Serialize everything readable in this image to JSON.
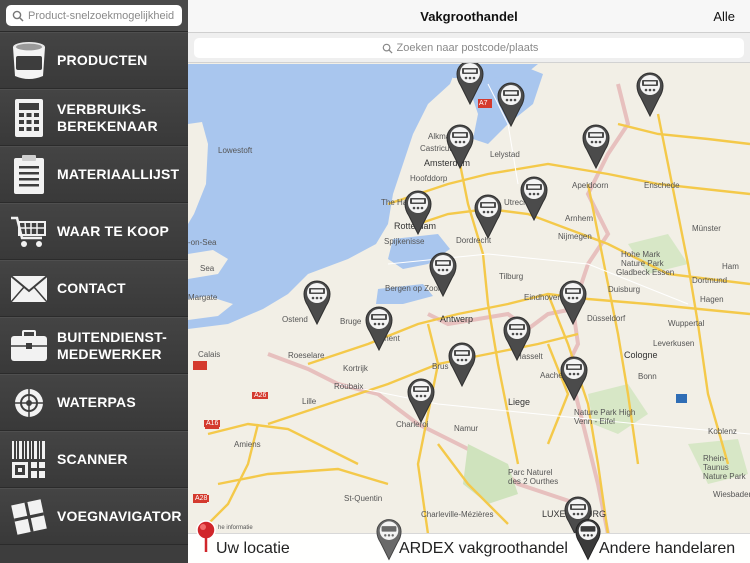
{
  "sidebar": {
    "search_placeholder": "Product-snelzoekmogelijkheid",
    "items": [
      {
        "label": "PRODUCTEN",
        "icon": "bucket-icon"
      },
      {
        "label": "VERBRUIKS-\nBEREKENAAR",
        "icon": "calculator-icon"
      },
      {
        "label": "MATERIAALLIJST",
        "icon": "list-icon"
      },
      {
        "label": "WAAR TE KOOP",
        "icon": "cart-icon"
      },
      {
        "label": "CONTACT",
        "icon": "envelope-icon"
      },
      {
        "label": "BUITENDIENST-\nMEDEWERKER",
        "icon": "briefcase-icon"
      },
      {
        "label": "WATERPAS",
        "icon": "level-icon"
      },
      {
        "label": "SCANNER",
        "icon": "qr-code-icon"
      },
      {
        "label": "VOEGNAVIGATOR",
        "icon": "tile-icon"
      }
    ]
  },
  "nav": {
    "title": "Vakgroothandel",
    "right_label": "Alle"
  },
  "postcode_search": {
    "placeholder": "Zoeken naar postcode/plaats"
  },
  "map": {
    "labels": {
      "lowestoft": "Lowestoft",
      "castricum": "Castricum",
      "alkmaar": "Alkmaar",
      "amsterdam": "Amsterdam",
      "lelystad": "Lelystad",
      "hoofddorp": "Hoofddorp",
      "apeldoorn": "Apeldoorn",
      "enschede": "Enschede",
      "thehague": "The Ha",
      "rotterdam": "Rotterdam",
      "utrecht": "Utrecht",
      "arnhem": "Arnhem",
      "nijmegen": "Nijmegen",
      "dordrecht": "Dordrecht",
      "spijkenisse": "Spijkenisse",
      "onsea": "-on-Sea",
      "munster": "Münster",
      "hohemark": "Hohe Mark\nNature Park",
      "gladbeck": "Gladbeck Essen",
      "dortmund": "Dortmund",
      "hamm": "Ham",
      "tilburg": "Tilburg",
      "bergenopzoom": "Bergen op Zoom",
      "eindhoven": "Eindhoven",
      "duisburg": "Duisburg",
      "hagen": "Hagen",
      "sea": "Sea",
      "margate": "Margate",
      "ostend": "Ostend",
      "brugge": "Bruge",
      "antwerp": "Antwerp",
      "dusseldorf": "Düsseldorf",
      "wuppertal": "Wuppertal",
      "gent": "Ghent",
      "leverkusen": "Leverkusen",
      "calais": "Calais",
      "roeselare": "Roeselare",
      "kortrijk": "Kortrijk",
      "brussels": "Brus",
      "hasselt": "Hasselt",
      "aachen": "Aache",
      "cologne": "Cologne",
      "bonn": "Bonn",
      "roubaix": "Roubaix",
      "lille": "Lille",
      "a26": "A26",
      "liege": "Liege",
      "naturepark": "Nature Park High\nVenn - Eifel",
      "koblenz": "Koblenz",
      "a16": "A16",
      "amiens": "Amiens",
      "charleroi": "Charleroi",
      "namur": "Namur",
      "rheintaunus": "Rhein-Taunus\nNature Park",
      "wiesbaden": "Wiesbaden",
      "parcnaturel": "Parc Naturel\ndes 2 Ourthes",
      "a28": "A28",
      "stquentin": "St-Quentin",
      "charleville": "Charleville-Mézières",
      "luxembourg": "LUXEMBOURG",
      "a7": "A7",
      "infohint": "he informatie"
    }
  },
  "legend": {
    "own_location": "Uw locatie",
    "ardex": "ARDEX vakgroothandel",
    "other": "Andere handelaren"
  },
  "colors": {
    "sidebar_bg": "#3d3d3d",
    "pin_dark": "#4b4b4b",
    "pin_red": "#d0262b",
    "map_land": "#f2efe6",
    "map_sea": "#a9c6ee"
  }
}
